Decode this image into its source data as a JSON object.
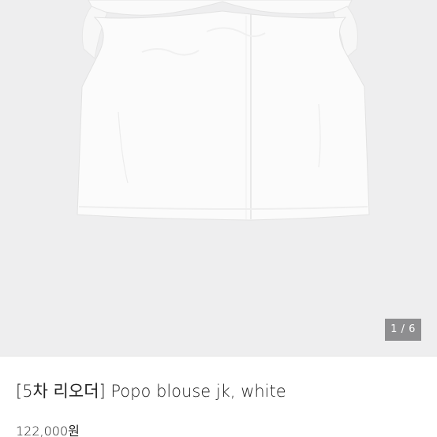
{
  "gallery": {
    "image_subject": "white blouse",
    "counter": "1 / 6"
  },
  "product": {
    "title": "[5차 리오더] Popo blouse jk, white",
    "price": "122,000원"
  }
}
